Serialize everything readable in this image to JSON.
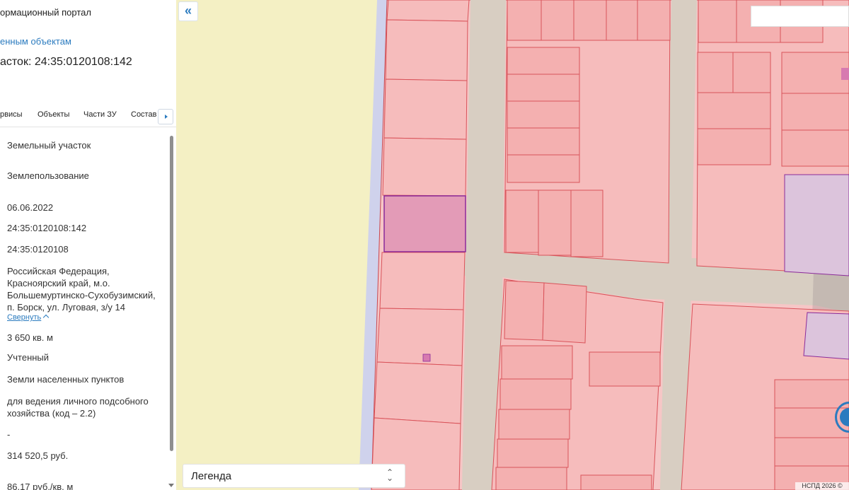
{
  "panel": {
    "portal_title": "ормационный портал",
    "back_link": "енным объектам",
    "parcel_title": "асток: 24:35:0120108:142",
    "tabs": [
      "рвисы",
      "Объекты",
      "Части ЗУ",
      "Состав"
    ],
    "fields": [
      "Земельный участок",
      "Землепользование",
      "06.06.2022",
      "24:35:0120108:142",
      "24:35:0120108",
      "Российская Федерация, Красноярский край, м.о. Большемуртинско-Сухобузимский, п. Борск, ул. Луговая, з/у 14",
      "3 650 кв. м",
      "Учтенный",
      "Земли населенных пунктов",
      "для ведения личного подсобного хозяйства (код – 2.2)",
      "-",
      "314 520,5 руб.",
      "86,17 руб./кв. м"
    ],
    "collapse_link": "Свернуть"
  },
  "map": {
    "collapse_glyph": "«",
    "legend_label": "Легенда",
    "legend_chevron": "⌃⌄",
    "copyright": "НСПД 2026 ©",
    "search_value": ""
  },
  "colors": {
    "accent": "#2b7bbf",
    "parcel_fill": "#f6c3c3",
    "parcel_stroke": "#d9535a",
    "selected_fill": "#e39bb7",
    "selected_stroke": "#8a2b9a",
    "road": "#d8cec2",
    "field": "#f4f0c4"
  },
  "icons": [
    "chevron-double-left-icon",
    "chevron-right-icon",
    "chevron-up-icon",
    "location-icon"
  ]
}
